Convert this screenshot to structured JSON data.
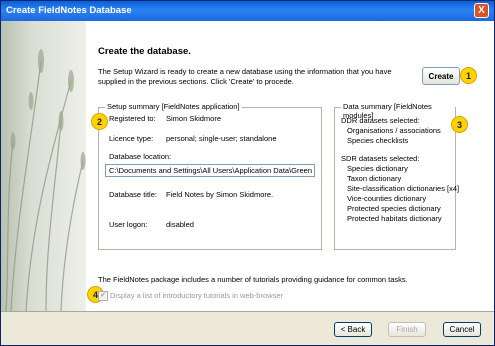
{
  "window": {
    "title": "Create FieldNotes Database",
    "close_glyph": "X"
  },
  "main": {
    "heading": "Create the database.",
    "intro": "The Setup Wizard is ready to create a new database using the information that you have supplied in the previous sections.  Click 'Create' to procede.",
    "create_label": "Create"
  },
  "badges": [
    "1",
    "2",
    "3",
    "4"
  ],
  "setup": {
    "legend": "Setup summary  [FieldNotes application]",
    "registered_label": "Registered to:",
    "registered_value": "Simon Skidmore",
    "licence_label": "Licence type:",
    "licence_value": "personal; single-user; standalone",
    "location_label": "Database location:",
    "location_value": "C:\\Documents and Settings\\All Users\\Application Data\\Green",
    "title_label": "Database title:",
    "title_value": "Field Notes by Simon Skidmore.",
    "logon_label": "User logon:",
    "logon_value": "disabled"
  },
  "data_summary": {
    "legend": "Data summary  [FieldNotes modules]",
    "ddr_heading": "DDR datasets selected:",
    "ddr_items": [
      "Organisations / associations",
      "Species checklists"
    ],
    "sdr_heading": "SDR datasets selected:",
    "sdr_items": [
      "Species dictionary",
      "Taxon dictionary",
      "Site-classification dictionaries [x4]",
      "Vice-counties dictionary",
      "Protected species dictionary",
      "Protected habitats dictionary"
    ]
  },
  "footer": {
    "info": "The FieldNotes package includes a number of tutorials providing guidance for common tasks.",
    "checkbox_label": "Display a list of introductory tutorials in web-browser",
    "checkbox_checked": true
  },
  "buttons": {
    "back": "< Back",
    "finish": "Finish",
    "cancel": "Cancel"
  }
}
